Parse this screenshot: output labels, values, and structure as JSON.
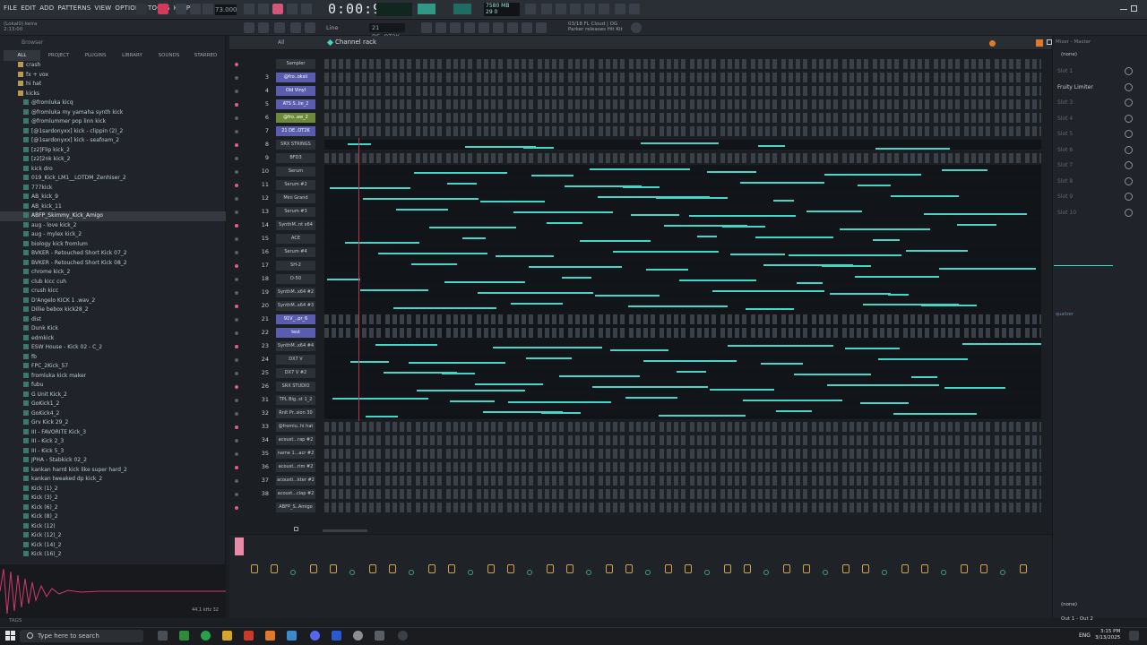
{
  "menu": [
    "FILE",
    "EDIT",
    "ADD",
    "PATTERNS",
    "VIEW",
    "OPTIONS",
    "TOOLS",
    "HELP"
  ],
  "transport": {
    "tempo": "73.000",
    "time": "0:00:97",
    "cpu_line1": "7580 MB",
    "cpu_line2": "29 0",
    "snap": "21 DE..OT2K",
    "tool_mode": "Line"
  },
  "hint": {
    "line1": "(Lokal0) keira",
    "line2": "2:13:00"
  },
  "news": {
    "line1": "03/18  FL Cloud | OG",
    "line2": "Parker releases Hit Kit"
  },
  "browser": {
    "title": "Browser",
    "tabs": [
      "ALL",
      "PROJECT",
      "PLUGINS",
      "LIBRARY",
      "SOUNDS",
      "STARRED"
    ],
    "items": [
      {
        "label": "crash",
        "kind": "fold"
      },
      {
        "label": "fx + vox",
        "kind": "fold"
      },
      {
        "label": "hi hat",
        "kind": "fold"
      },
      {
        "label": "kicks",
        "kind": "fold"
      },
      {
        "label": "@fromluka kicq",
        "kind": "file"
      },
      {
        "label": "@fromluka my yamaha synth kick",
        "kind": "file"
      },
      {
        "label": "@fromlummer pop linn kick",
        "kind": "file"
      },
      {
        "label": "[@1sardonyxx] kick - clippin (2)_2",
        "kind": "file"
      },
      {
        "label": "[@1sardonyxx] kick - seafoam_2",
        "kind": "file"
      },
      {
        "label": "[z2]Flip kick_2",
        "kind": "file"
      },
      {
        "label": "[z2]2nk kick_2",
        "kind": "file"
      },
      {
        "label": "kick dro",
        "kind": "file"
      },
      {
        "label": "019_Kick_LM1__LOTDM_Zenhiser_2",
        "kind": "file"
      },
      {
        "label": "777kick",
        "kind": "file"
      },
      {
        "label": "AB_kick_9",
        "kind": "file"
      },
      {
        "label": "AB_kick_11",
        "kind": "file"
      },
      {
        "label": "ABFP_Skimmy_Kick_Amigo",
        "kind": "file",
        "selected": true
      },
      {
        "label": "aug - love kick_2",
        "kind": "file"
      },
      {
        "label": "aug - mylex kick_2",
        "kind": "file"
      },
      {
        "label": "biology kick fromlum",
        "kind": "file"
      },
      {
        "label": "BVKER - Retouched Short Kick 07_2",
        "kind": "file"
      },
      {
        "label": "BVKER - Retouched Short Kick 08_2",
        "kind": "file"
      },
      {
        "label": "chrome kick_2",
        "kind": "file"
      },
      {
        "label": "club kicc cuh",
        "kind": "file"
      },
      {
        "label": "crush kicc",
        "kind": "file"
      },
      {
        "label": "D'Angelo KICK 1 .wav_2",
        "kind": "file"
      },
      {
        "label": "Dillie bebox kick28_2",
        "kind": "file"
      },
      {
        "label": "dist",
        "kind": "file"
      },
      {
        "label": "Dunk Kick",
        "kind": "file"
      },
      {
        "label": "edmkick",
        "kind": "file"
      },
      {
        "label": "ESW House - Kick 02 - C_2",
        "kind": "file"
      },
      {
        "label": "fb",
        "kind": "file"
      },
      {
        "label": "FPC_2Kick_57",
        "kind": "file"
      },
      {
        "label": "fromluka kick maker",
        "kind": "file"
      },
      {
        "label": "fubu",
        "kind": "file"
      },
      {
        "label": "G Unit Kick_2",
        "kind": "file"
      },
      {
        "label": "GoKick1_2",
        "kind": "file"
      },
      {
        "label": "GoKick4_2",
        "kind": "file"
      },
      {
        "label": "Grv Kick 29_2",
        "kind": "file"
      },
      {
        "label": "III - FAVORITE Kick_3",
        "kind": "file"
      },
      {
        "label": "III - Kick 2_3",
        "kind": "file"
      },
      {
        "label": "III - Kick 5_3",
        "kind": "file"
      },
      {
        "label": "JPHA - Stabkick 02_2",
        "kind": "file"
      },
      {
        "label": "kankan harrd kick like super hard_2",
        "kind": "file"
      },
      {
        "label": "kankan tweaked dp kick_2",
        "kind": "file"
      },
      {
        "label": "Kick (1)_2",
        "kind": "file"
      },
      {
        "label": "Kick (3)_2",
        "kind": "file"
      },
      {
        "label": "Kick (6)_2",
        "kind": "file"
      },
      {
        "label": "Kick (8)_2",
        "kind": "file"
      },
      {
        "label": "Kick (12)",
        "kind": "file"
      },
      {
        "label": "Kick (12)_2",
        "kind": "file"
      },
      {
        "label": "Kick (14)_2",
        "kind": "file"
      },
      {
        "label": "Kick (16)_2",
        "kind": "file"
      }
    ],
    "wave_info": "44.1 kHz 32",
    "tags": "TAGS"
  },
  "channel_rack": {
    "title": "Channel rack",
    "filter": "All",
    "channels": [
      {
        "num": "",
        "name": "Sampler",
        "type": "steps"
      },
      {
        "num": "3",
        "name": "@fro..oksii",
        "type": "steps",
        "hl": "hl"
      },
      {
        "num": "4",
        "name": "Old Vinyl",
        "type": "steps",
        "hl": "hl"
      },
      {
        "num": "5",
        "name": "ATS S..lie_2",
        "type": "steps",
        "hl": "hl"
      },
      {
        "num": "6",
        "name": "@fro..aw_2",
        "type": "steps",
        "hl": "hlg"
      },
      {
        "num": "7",
        "name": "21 DE..OT2K",
        "type": "steps",
        "hl": "hl"
      },
      {
        "num": "8",
        "name": "SRX STRINGS",
        "type": "roll"
      },
      {
        "num": "9",
        "name": "BFD3",
        "type": "steps"
      },
      {
        "num": "10",
        "name": "Serum",
        "type": "roll"
      },
      {
        "num": "11",
        "name": "Serum #2",
        "type": "roll"
      },
      {
        "num": "12",
        "name": "Mini Grand",
        "type": "roll"
      },
      {
        "num": "13",
        "name": "Serum #3",
        "type": "roll"
      },
      {
        "num": "14",
        "name": "SynthM..nt x64",
        "type": "roll"
      },
      {
        "num": "15",
        "name": "ACE",
        "type": "roll"
      },
      {
        "num": "16",
        "name": "Serum #4",
        "type": "roll"
      },
      {
        "num": "17",
        "name": "SH-2",
        "type": "roll"
      },
      {
        "num": "18",
        "name": "D-50",
        "type": "roll"
      },
      {
        "num": "19",
        "name": "SynthM..x64 #2",
        "type": "roll"
      },
      {
        "num": "20",
        "name": "SynthM..x64 #3",
        "type": "roll"
      },
      {
        "num": "21",
        "name": "91V_..pr_6",
        "type": "steps",
        "hl": "hl"
      },
      {
        "num": "22",
        "name": "test",
        "type": "steps",
        "hl": "hl"
      },
      {
        "num": "23",
        "name": "SynthM..x64 #4",
        "type": "roll"
      },
      {
        "num": "24",
        "name": "DX7 V",
        "type": "roll"
      },
      {
        "num": "25",
        "name": "DX7 V #2",
        "type": "roll"
      },
      {
        "num": "26",
        "name": "SRX STUDIO",
        "type": "roll"
      },
      {
        "num": "31",
        "name": "TPL Big..st 1_2",
        "type": "roll"
      },
      {
        "num": "32",
        "name": "Rnlt Pr..sion 30",
        "type": "roll"
      },
      {
        "num": "33",
        "name": "@fromlu..hi hat",
        "type": "steps"
      },
      {
        "num": "34",
        "name": "acoust...rap #2",
        "type": "steps"
      },
      {
        "num": "35",
        "name": "name 1...acr #2",
        "type": "steps"
      },
      {
        "num": "36",
        "name": "acoust...rim #2",
        "type": "steps"
      },
      {
        "num": "37",
        "name": "acousti...kter #2",
        "type": "steps"
      },
      {
        "num": "38",
        "name": "acoust...clap #2",
        "type": "steps"
      },
      {
        "num": "",
        "name": "ABFP_S..Amigo",
        "type": "steps"
      }
    ]
  },
  "mixer_panel": {
    "title": "Mixer - Master",
    "top_select": "(none)",
    "slots": [
      {
        "label": "Slot 1",
        "active": false
      },
      {
        "label": "Fruity Limiter",
        "active": true
      },
      {
        "label": "Slot 3",
        "active": false
      },
      {
        "label": "Slot 4",
        "active": false
      },
      {
        "label": "Slot 5",
        "active": false
      },
      {
        "label": "Slot 6",
        "active": false
      },
      {
        "label": "Slot 7",
        "active": false
      },
      {
        "label": "Slot 8",
        "active": false
      },
      {
        "label": "Slot 9",
        "active": false
      },
      {
        "label": "Slot 10",
        "active": false
      }
    ],
    "eq_label": "qualizer",
    "bottom_select": "(none)",
    "output": "Out 1 - Out 2"
  },
  "taskbar": {
    "search_placeholder": "Type here to search",
    "lang": "ENG",
    "time": "3:15 PM",
    "date": "3/13/2025"
  },
  "colors": {
    "accent_teal": "#46d6c8",
    "playhead": "#c2344a",
    "highlight_channel": "#5a5dae"
  }
}
